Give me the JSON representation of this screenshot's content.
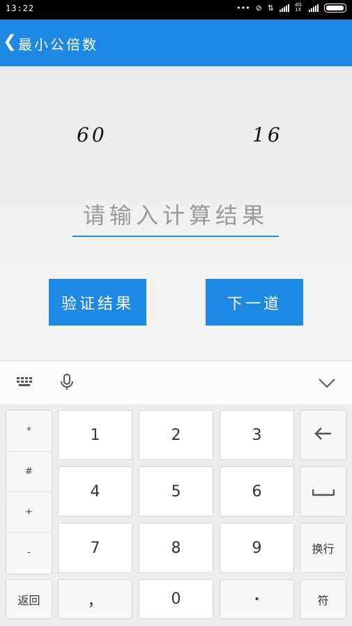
{
  "status": {
    "time": "13:22",
    "network": "4G 1X"
  },
  "app": {
    "title": "最小公倍数"
  },
  "problem": {
    "num1": "60",
    "num2": "16"
  },
  "answer_input": {
    "placeholder": "请输入计算结果",
    "value": ""
  },
  "buttons": {
    "verify": "验证结果",
    "next": "下一道"
  },
  "keyboard": {
    "symbols": [
      "*",
      "#",
      "+",
      "-"
    ],
    "digits": [
      "1",
      "2",
      "3",
      "4",
      "5",
      "6",
      "7",
      "8",
      "9",
      "0"
    ],
    "comma": "，",
    "dot": "•",
    "back_label": "返回",
    "newline_label": "换行",
    "symbol_label": "符"
  },
  "colors": {
    "primary": "#1e88e5",
    "statusbar": "#000000"
  }
}
